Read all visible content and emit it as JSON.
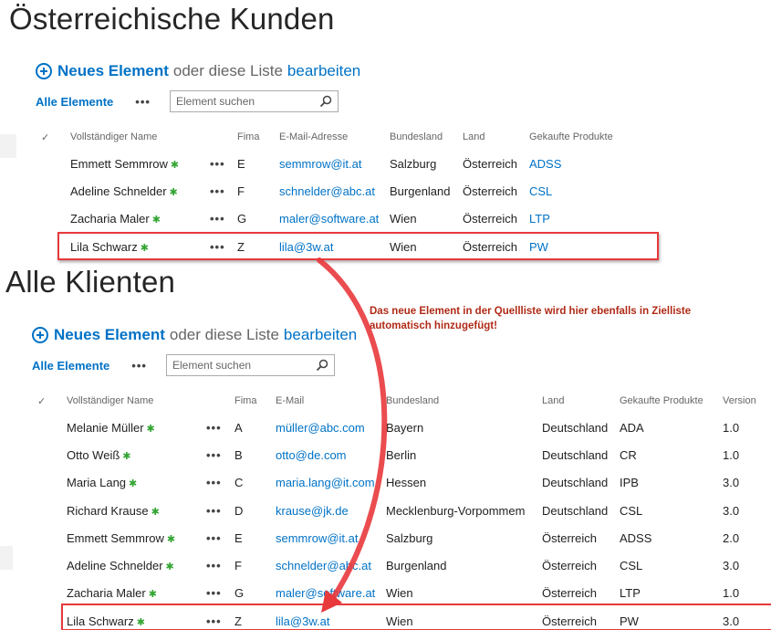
{
  "lists": [
    {
      "title": "Österreichische Kunden",
      "command": {
        "new_item": "Neues Element",
        "middle": "oder diese Liste",
        "edit": "bearbeiten"
      },
      "view": {
        "all_items": "Alle Elemente",
        "more": "•••"
      },
      "search": {
        "placeholder": "Element suchen",
        "icon": "search-icon"
      },
      "headers": [
        "✓",
        "Vollständiger Name",
        "Fima",
        "E-Mail-Adresse",
        "Bundesland",
        "Land",
        "Gekaufte Produkte"
      ],
      "rows": [
        {
          "name": "Emmett Semmrow",
          "firma": "E",
          "email": "semmrow@it.at",
          "bundesland": "Salzburg",
          "land": "Österreich",
          "produkte": "ADSS"
        },
        {
          "name": "Adeline Schnelder",
          "firma": "F",
          "email": "schnelder@abc.at",
          "bundesland": "Burgenland",
          "land": "Österreich",
          "produkte": "CSL"
        },
        {
          "name": "Zacharia Maler",
          "firma": "G",
          "email": "maler@software.at",
          "bundesland": "Wien",
          "land": "Österreich",
          "produkte": "LTP"
        },
        {
          "name": "Lila Schwarz",
          "firma": "Z",
          "email": "lila@3w.at",
          "bundesland": "Wien",
          "land": "Österreich",
          "produkte": "PW"
        }
      ]
    },
    {
      "title": "Alle Klienten",
      "command": {
        "new_item": "Neues Element",
        "middle": "oder diese Liste",
        "edit": "bearbeiten"
      },
      "view": {
        "all_items": "Alle Elemente",
        "more": "•••"
      },
      "search": {
        "placeholder": "Element suchen",
        "icon": "search-icon"
      },
      "headers": [
        "✓",
        "Vollständiger Name",
        "Fima",
        "E-Mail",
        "Bundesland",
        "Land",
        "Gekaufte Produkte",
        "Version"
      ],
      "rows": [
        {
          "name": "Melanie Müller",
          "firma": "A",
          "email": "müller@abc.com",
          "bundesland": "Bayern",
          "land": "Deutschland",
          "produkte": "ADA",
          "version": "1.0"
        },
        {
          "name": "Otto Weiß",
          "firma": "B",
          "email": "otto@de.com",
          "bundesland": "Berlin",
          "land": "Deutschland",
          "produkte": "CR",
          "version": "1.0"
        },
        {
          "name": "Maria Lang",
          "firma": "C",
          "email": "maria.lang@it.com",
          "bundesland": "Hessen",
          "land": "Deutschland",
          "produkte": "IPB",
          "version": "3.0"
        },
        {
          "name": "Richard Krause",
          "firma": "D",
          "email": "krause@jk.de",
          "bundesland": "Mecklenburg-Vorpommem",
          "land": "Deutschland",
          "produkte": "CSL",
          "version": "3.0"
        },
        {
          "name": "Emmett Semmrow",
          "firma": "E",
          "email": "semmrow@it.at",
          "bundesland": "Salzburg",
          "land": "Österreich",
          "produkte": "ADSS",
          "version": "2.0"
        },
        {
          "name": "Adeline Schnelder",
          "firma": "F",
          "email": "schnelder@abc.at",
          "bundesland": "Burgenland",
          "land": "Österreich",
          "produkte": "CSL",
          "version": "3.0"
        },
        {
          "name": "Zacharia Maler",
          "firma": "G",
          "email": "maler@software.at",
          "bundesland": "Wien",
          "land": "Österreich",
          "produkte": "LTP",
          "version": "1.0"
        },
        {
          "name": "Lila Schwarz",
          "firma": "Z",
          "email": "lila@3w.at",
          "bundesland": "Wien",
          "land": "Österreich",
          "produkte": "PW",
          "version": "3.0"
        }
      ]
    }
  ],
  "annotation": {
    "line1": "Das neue Element in der Quellliste wird hier ebenfalls in Zielliste",
    "line2": "automatisch hinzugefügt!"
  },
  "colors": {
    "accent": "#0072c6",
    "highlight": "#e8393c",
    "annotation": "#b02a16",
    "new_icon": "#33a533"
  },
  "icons": {
    "new_badge": "✱",
    "new_badge_name": "new-item-icon",
    "add_icon": "add-circle-icon",
    "row_menu": "ellipsis-icon",
    "arrow": "curved-arrow-icon"
  }
}
